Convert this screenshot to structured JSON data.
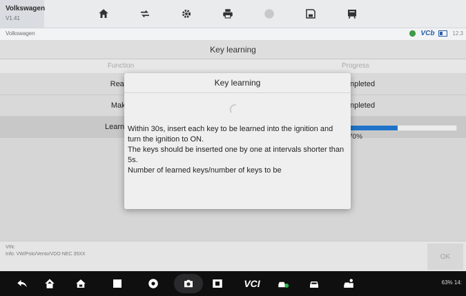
{
  "app": {
    "name": "Volkswagen",
    "version": "V1.41"
  },
  "toolbar": {
    "tools": [
      {
        "icon": "home-icon"
      },
      {
        "icon": "car-swap-icon"
      },
      {
        "icon": "settings-gear-icon"
      },
      {
        "icon": "print-icon"
      },
      {
        "icon": "help-icon"
      },
      {
        "icon": "save-icon"
      },
      {
        "icon": "data-logging-icon"
      }
    ]
  },
  "breadcrumb": {
    "text": "Volkswagen"
  },
  "status": {
    "vci_label": "VCb",
    "battery_label": "12.3"
  },
  "page": {
    "title": "Key learning",
    "columns": {
      "function": "Function",
      "progress": "Progress"
    },
    "rows": [
      {
        "function": "Read IMM",
        "progress": "npleted"
      },
      {
        "function": "Make dea",
        "progress": "npleted"
      },
      {
        "function": "Learn keys to",
        "progress": "70%",
        "progress_value": 0.45
      }
    ]
  },
  "info": {
    "vin_label": "VIN:",
    "info_text": "Info: VW/Polo/Vento/VDO NEC 35XX"
  },
  "ok_label": "OK",
  "dialog": {
    "title": "Key learning",
    "lines": [
      "Within 30s, insert each key to be learned into the ignition and turn the ignition to ON.",
      "The keys should be inserted one by one at intervals shorter than 5s.",
      "Number of learned keys/number of keys to be"
    ]
  },
  "navbar": {
    "vci_label": "VCI",
    "system_status": "63%  14:"
  },
  "colors": {
    "accent": "#1f73c9",
    "navbar": "#0f0f10"
  }
}
